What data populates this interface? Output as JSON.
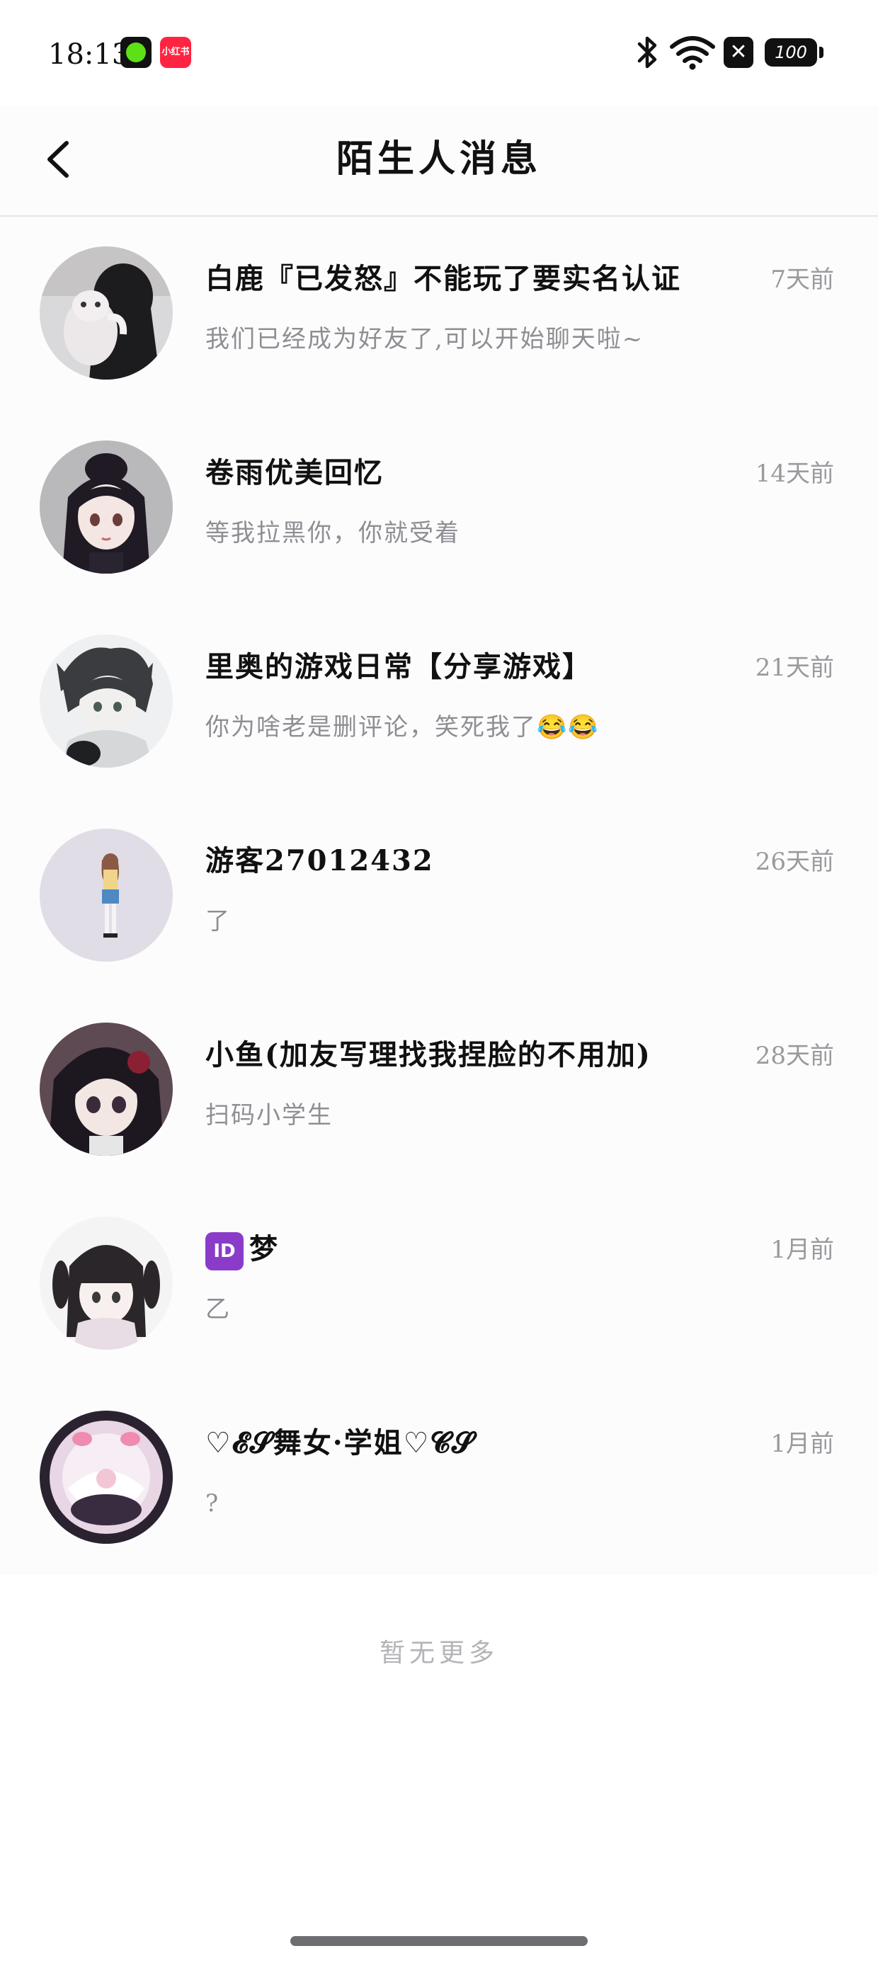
{
  "status_bar": {
    "time": "18:13",
    "app_icon_red_label": "小红书",
    "battery": "100",
    "icons": [
      "green-app-icon",
      "xiaohongshu-app-icon",
      "bluetooth-icon",
      "wifi-icon",
      "close-box-icon",
      "battery-icon"
    ]
  },
  "header": {
    "title": "陌生人消息",
    "back_icon": "chevron-left-icon"
  },
  "conversations": [
    {
      "name": "白鹿『已发怒』不能玩了要实名认证",
      "time": "7天前",
      "message": "我们已经成为好友了,可以开始聊天啦~"
    },
    {
      "name": "卷雨优美回忆",
      "time": "14天前",
      "message": "等我拉黑你，你就受着"
    },
    {
      "name": "里奥的游戏日常【分享游戏】",
      "time": "21天前",
      "message": "你为啥老是删评论，笑死我了😂😂"
    },
    {
      "name": "游客27012432",
      "time": "26天前",
      "message": "了"
    },
    {
      "name": "小鱼(加友写理找我捏脸的不用加)",
      "time": "28天前",
      "message": "扫码小学生"
    },
    {
      "name": "梦",
      "name_badge": "ID",
      "time": "1月前",
      "message": "乙"
    },
    {
      "name": "♡𝓔𝓢舞女·学姐♡𝓒𝓢",
      "time": "1月前",
      "message": "?"
    }
  ],
  "footer": {
    "no_more": "暂无更多"
  },
  "colors": {
    "background": "#fdfcfd",
    "title": "#111111",
    "secondary_text": "#8e8e93",
    "divider": "#e6e6e8",
    "id_badge": "#8a3cc9"
  }
}
